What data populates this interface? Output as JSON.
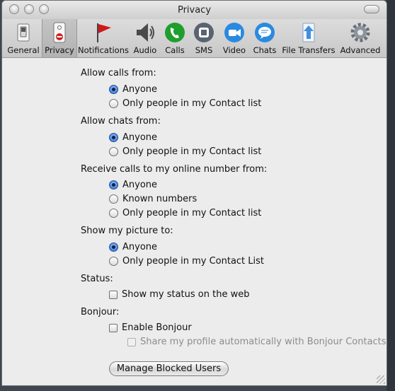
{
  "window": {
    "title": "Privacy"
  },
  "toolbar": {
    "items": [
      {
        "label": "General",
        "icon": "switch-icon"
      },
      {
        "label": "Privacy",
        "icon": "no-entry-sign-icon"
      },
      {
        "label": "Notifications",
        "icon": "red-flag-icon"
      },
      {
        "label": "Audio",
        "icon": "speaker-icon"
      },
      {
        "label": "Calls",
        "icon": "phone-icon"
      },
      {
        "label": "SMS",
        "icon": "sms-icon"
      },
      {
        "label": "Video",
        "icon": "video-camera-icon"
      },
      {
        "label": "Chats",
        "icon": "chat-bubble-icon"
      },
      {
        "label": "File Transfers",
        "icon": "upload-arrow-icon"
      },
      {
        "label": "Advanced",
        "icon": "gear-icon"
      }
    ],
    "selected": "Privacy"
  },
  "calls": {
    "label": "Allow calls from:",
    "opt1": "Anyone",
    "opt2": "Only people in my Contact list",
    "selected": "Anyone"
  },
  "chats": {
    "label": "Allow chats from:",
    "opt1": "Anyone",
    "opt2": "Only people in my Contact list",
    "selected": "Anyone"
  },
  "online": {
    "label": "Receive calls to my online number from:",
    "opt1": "Anyone",
    "opt2": "Known numbers",
    "opt3": "Only people in my Contact list",
    "selected": "Anyone"
  },
  "picture": {
    "label": "Show my picture to:",
    "opt1": "Anyone",
    "opt2": "Only people in my Contact List",
    "selected": "Anyone"
  },
  "status": {
    "label": "Status:",
    "show_web": "Show my status on the web",
    "show_web_checked": false
  },
  "bonjour": {
    "label": "Bonjour:",
    "enable": "Enable Bonjour",
    "enable_checked": false,
    "share": "Share my profile automatically with Bonjour Contacts",
    "share_checked": false,
    "share_enabled": false
  },
  "actions": {
    "manage_blocked": "Manage Blocked Users"
  },
  "colors": {
    "selected_radio": "#2a6bd6",
    "flag": "#d01818",
    "green": "#1f9e2e",
    "blue": "#2a8ae0"
  }
}
